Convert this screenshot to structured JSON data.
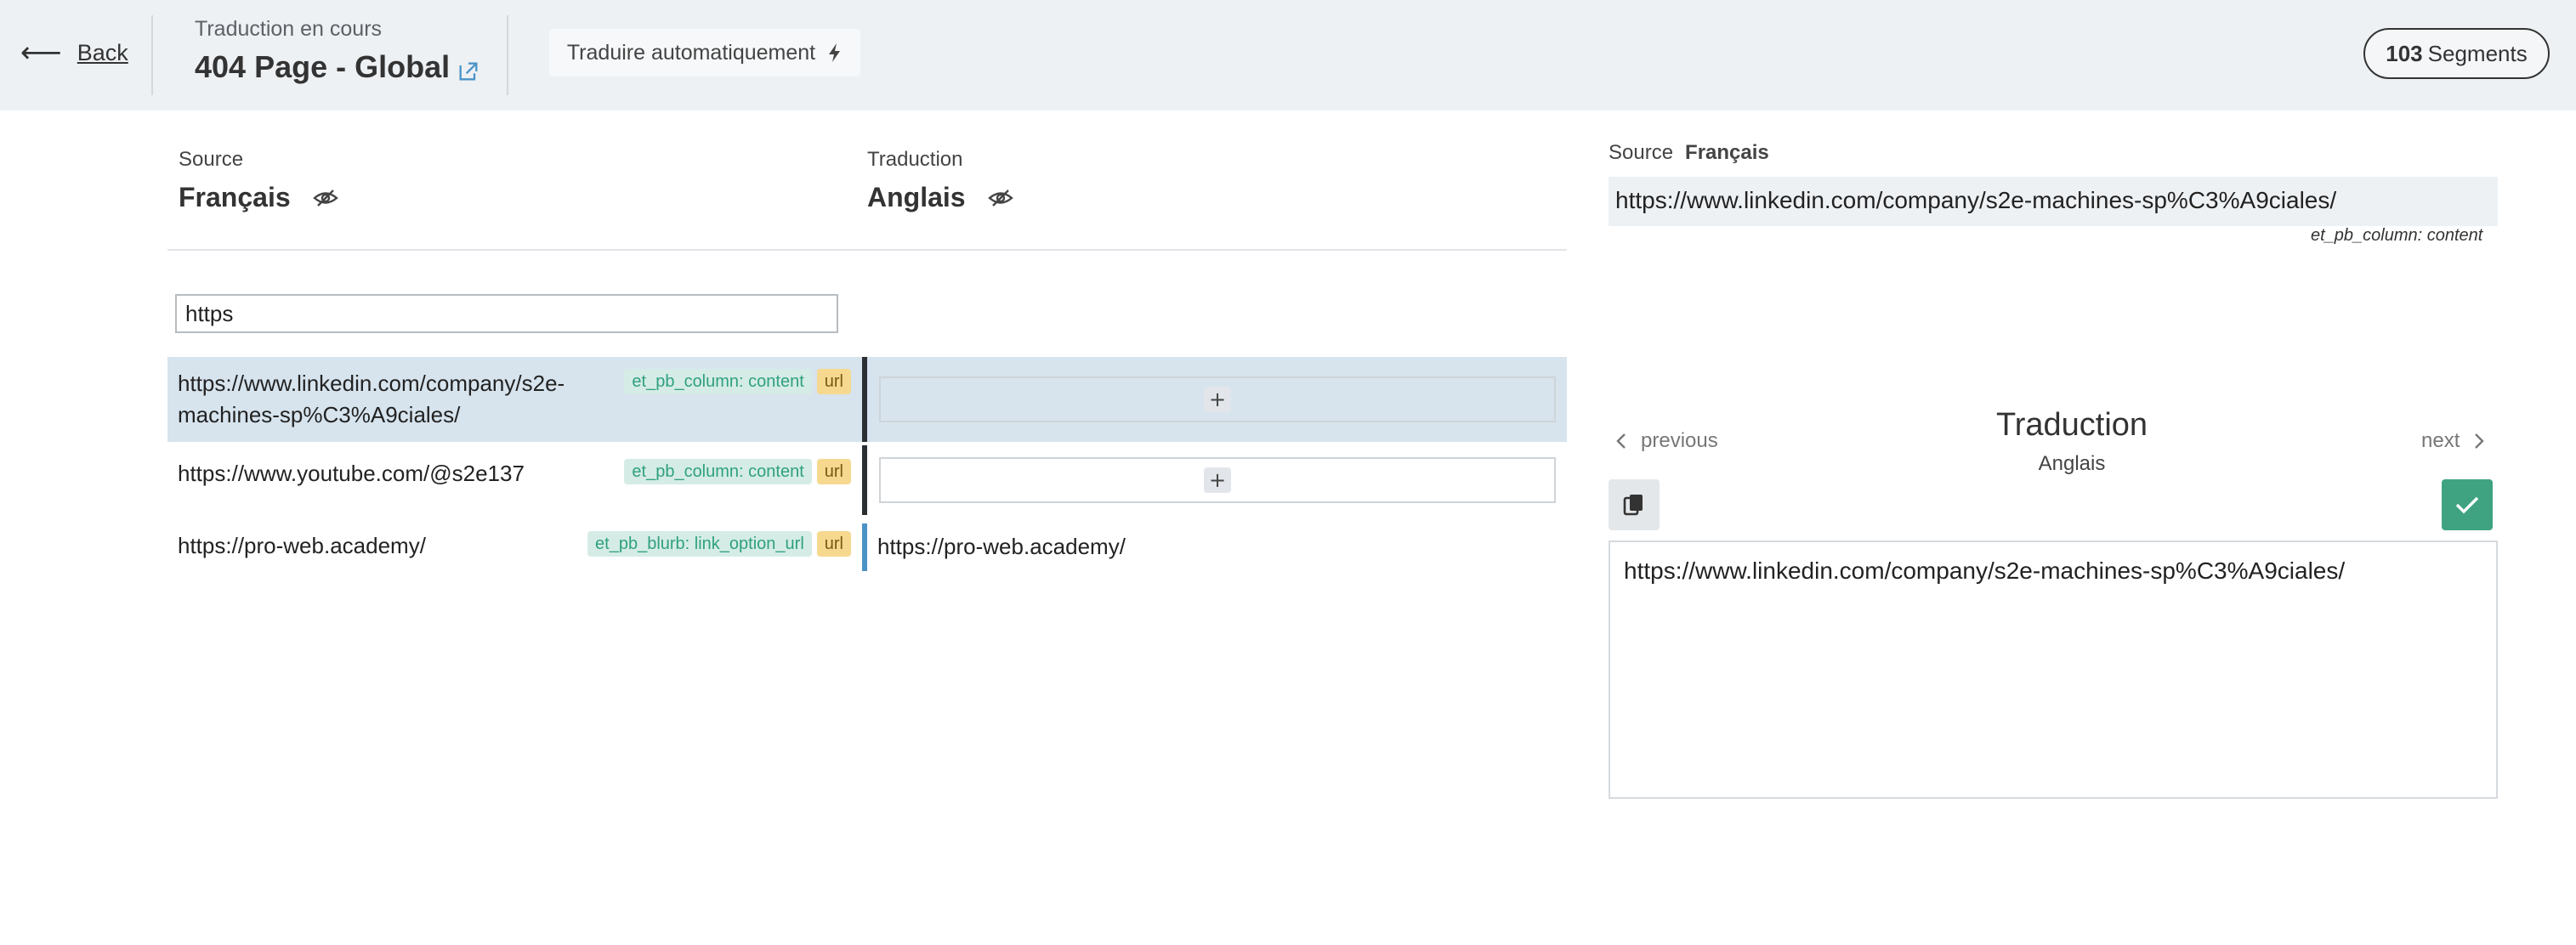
{
  "header": {
    "back_label": "Back",
    "status": "Traduction en cours",
    "title": "404 Page - Global",
    "auto_translate_label": "Traduire automatiquement",
    "segments_count": "103",
    "segments_label": "Segments"
  },
  "source": {
    "label": "Source",
    "language": "Français"
  },
  "target": {
    "label": "Traduction",
    "language": "Anglais"
  },
  "filter": {
    "value": "https"
  },
  "rows": [
    {
      "source_line1": "https://www.linkedin.com/company/s2e-",
      "source_line2": "machines-sp%C3%A9ciales/",
      "field_tag": "et_pb_column: content",
      "type_tag": "url",
      "add_label": "+"
    },
    {
      "source": "https://www.youtube.com/@s2e137",
      "field_tag": "et_pb_column: content",
      "type_tag": "url",
      "add_label": "+"
    },
    {
      "source": "https://pro-web.academy/",
      "field_tag": "et_pb_blurb: link_option_url",
      "type_tag": "url",
      "translation": "https://pro-web.academy/"
    }
  ],
  "editor_panel": {
    "source_label": "Source",
    "source_language": "Français",
    "source_text": "https://www.linkedin.com/company/s2e-machines-sp%C3%A9ciales/",
    "field": "et_pb_column: content",
    "previous_label": "previous",
    "next_label": "next",
    "title": "Traduction",
    "language": "Anglais",
    "translation_text": "https://www.linkedin.com/company/s2e-machines-sp%C3%A9ciales/"
  },
  "colors": {
    "header_bg": "#edf1f4",
    "selected_row": "#d7e4ee",
    "validate_green": "#3fa382",
    "field_tag_text": "#2fa07f",
    "url_tag_bg": "#f6d88f"
  },
  "icons": [
    "arrow-left-icon",
    "external-link-icon",
    "bolt-icon",
    "eye-slash-icon",
    "plus-icon",
    "chevron-left-icon",
    "chevron-right-icon",
    "copy-icon",
    "check-icon"
  ]
}
